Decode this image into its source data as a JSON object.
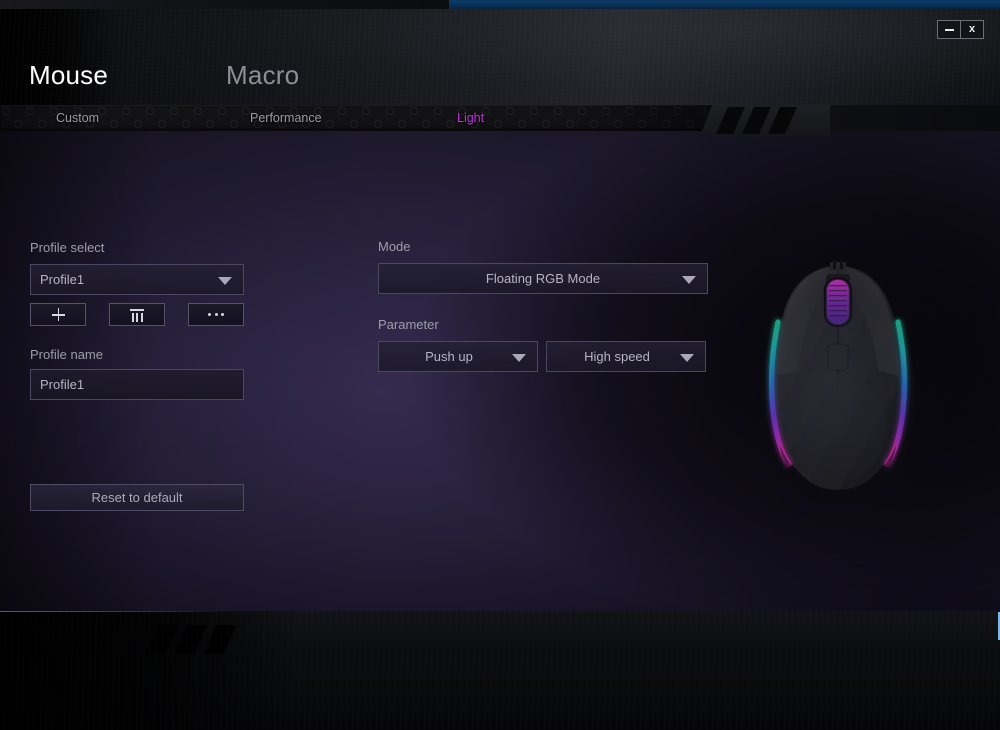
{
  "window": {
    "minimize_label": "minimize",
    "close_label": "x"
  },
  "main_tabs": [
    {
      "label": "Mouse",
      "active": true
    },
    {
      "label": "Macro",
      "active": false
    }
  ],
  "sub_tabs": [
    {
      "label": "Custom",
      "active": false
    },
    {
      "label": "Performance",
      "active": false
    },
    {
      "label": "Light",
      "active": true
    }
  ],
  "left_panel": {
    "profile_select_label": "Profile select",
    "profile_select_value": "Profile1",
    "add_button": "+",
    "delete_button": "trash-icon",
    "more_button": "...",
    "profile_name_label": "Profile name",
    "profile_name_value": "Profile1",
    "reset_button": "Reset to default"
  },
  "center_panel": {
    "mode_label": "Mode",
    "mode_value": "Floating RGB Mode",
    "parameter_label": "Parameter",
    "parameter_direction_value": "Push up",
    "parameter_speed_value": "High speed"
  },
  "colors": {
    "active_subtab": "#c030e0",
    "accent_blue": "#7fb6e8",
    "panel_purple": "#1d1930",
    "text_muted": "#9d9daa"
  }
}
